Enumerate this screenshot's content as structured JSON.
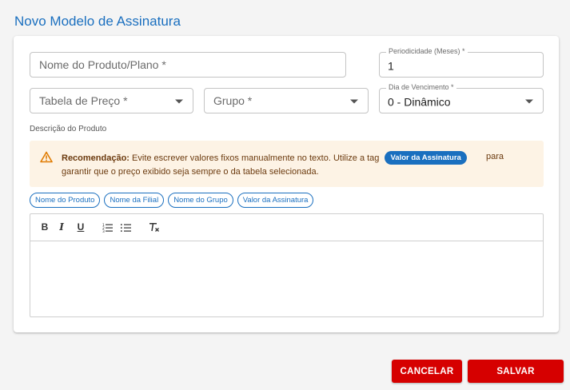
{
  "page": {
    "title": "Novo Modelo de Assinatura"
  },
  "form": {
    "product_name": {
      "placeholder": "Nome do Produto/Plano *"
    },
    "periodicity": {
      "label": "Periodicidade (Meses) *",
      "value": "1"
    },
    "price_table": {
      "placeholder": "Tabela de Preço *"
    },
    "group": {
      "placeholder": "Grupo *"
    },
    "due_day": {
      "label": "Dia de Vencimento *",
      "value": "0 - Dinâmico"
    },
    "description_label": "Descrição do Produto"
  },
  "alert": {
    "bold": "Recomendação:",
    "text1": "Evite escrever valores fixos manualmente no texto. Utilize a tag",
    "tag": "Valor da Assinatura",
    "text_tail": "para",
    "text2": "garantir que o preço exibido seja sempre o da tabela selecionada."
  },
  "chips": [
    "Nome do Produto",
    "Nome da Filial",
    "Nome do Grupo",
    "Valor da Assinatura"
  ],
  "toolbar": {
    "bold": "B",
    "italic": "I",
    "underline": "U"
  },
  "actions": {
    "cancel": "CANCELAR",
    "save": "SALVAR"
  },
  "colors": {
    "primary": "#1a6fbf",
    "danger": "#d60000",
    "alert_bg": "#fdf3e5",
    "warning": "#e07b00"
  }
}
